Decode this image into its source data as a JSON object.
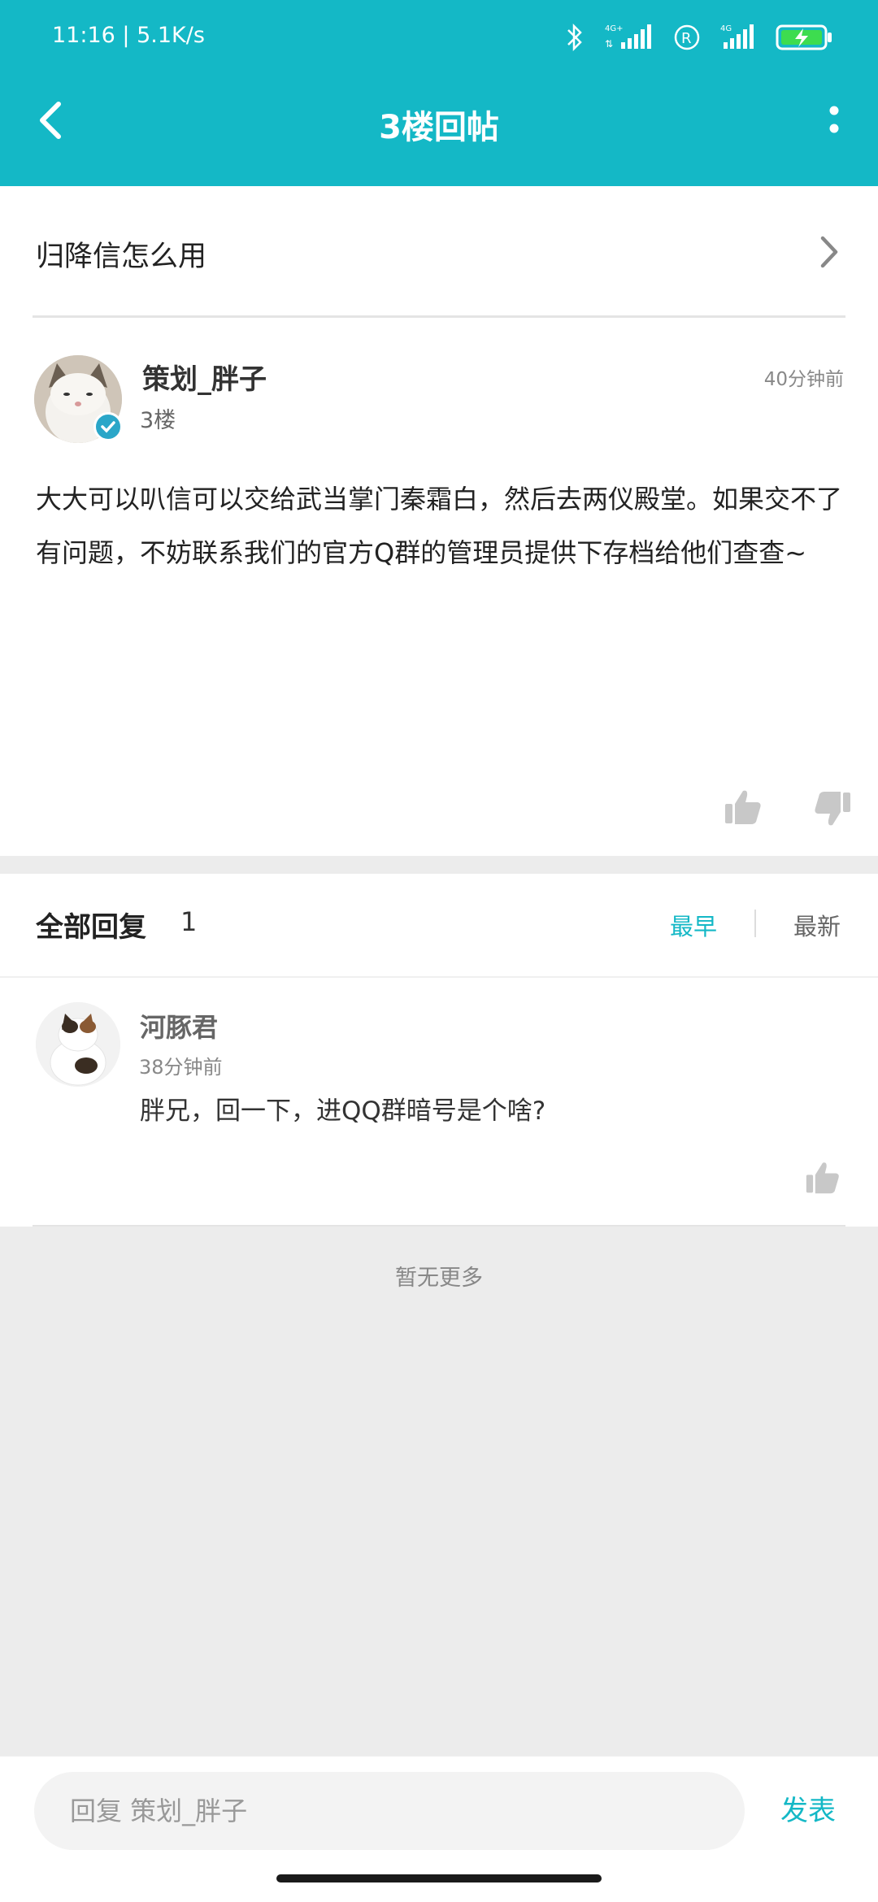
{
  "status_bar": {
    "time": "11:16",
    "network_speed": "5.1K/s",
    "icons": [
      "bluetooth-icon",
      "signal-4g-plus-icon",
      "roaming-icon",
      "signal-4g-icon",
      "battery-charging-icon"
    ]
  },
  "header": {
    "title": "3楼回帖",
    "background": "#14b8c6"
  },
  "thread": {
    "title": "归降信怎么用"
  },
  "post": {
    "author": "策划_胖子",
    "floor": "3楼",
    "time": "40分钟前",
    "content": "大大可以叭信可以交给武当掌门秦霜白，然后去两仪殿堂。如果交不了有问题，不妨联系我们的官方Q群的管理员提供下存档给他们查查~"
  },
  "replies": {
    "title": "全部回复",
    "count": "1",
    "sort_earliest": "最早",
    "sort_newest": "最新",
    "active_sort": "最早",
    "items": [
      {
        "author": "河豚君",
        "time": "38分钟前",
        "content": "胖兄，回一下，进QQ群暗号是个啥?"
      }
    ],
    "no_more": "暂无更多"
  },
  "composer": {
    "placeholder": "回复 策划_胖子",
    "send_label": "发表"
  },
  "colors": {
    "accent": "#14b8c6",
    "page_background": "#ececec"
  }
}
